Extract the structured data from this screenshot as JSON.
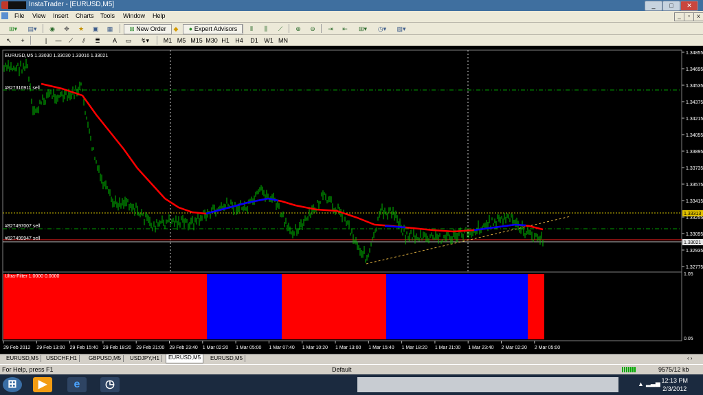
{
  "window": {
    "title": "InstaTrader - [EURUSD,M5]",
    "controls": [
      "_",
      "□",
      "✕"
    ],
    "mdi_controls": [
      "_",
      "▫",
      "x"
    ]
  },
  "menu": [
    "File",
    "View",
    "Insert",
    "Charts",
    "Tools",
    "Window",
    "Help"
  ],
  "toolbar1": {
    "new_order": "New Order",
    "expert_advisors": "Expert Advisors"
  },
  "toolbar2": {
    "text_tool": "A",
    "timeframes": [
      "M1",
      "M5",
      "M15",
      "M30",
      "H1",
      "H4",
      "D1",
      "W1",
      "MN"
    ]
  },
  "chart": {
    "header": "EURUSD,M5  1.33030 1.33030 1.33016 1.33021",
    "orders": [
      "#827316911 sell",
      "#827497007 sell",
      "#827499947 sell"
    ],
    "price_axis": [
      "1.34855",
      "1.34695",
      "1.34535",
      "1.34375",
      "1.34215",
      "1.34055",
      "1.33895",
      "1.33735",
      "1.33575",
      "1.33415",
      "1.33255",
      "1.33095",
      "1.32935",
      "1.32775"
    ],
    "highlight_prices": {
      "bid": "1.33313",
      "current": "1.33021"
    },
    "indicator_label": "Ultra-Filter 1.0000 0.0000",
    "indicator_axis": {
      "top": "1.05",
      "bottom": "0.05"
    },
    "time_axis": [
      "29 Feb 2012",
      "29 Feb 13:00",
      "29 Feb 15:40",
      "29 Feb 18:20",
      "29 Feb 21:00",
      "29 Feb 23:40",
      "1 Mar 02:20",
      "1 Mar 05:00",
      "1 Mar 07:40",
      "1 Mar 10:20",
      "1 Mar 13:00",
      "1 Mar 15:40",
      "1 Mar 18:20",
      "1 Mar 21:00",
      "1 Mar 23:40",
      "2 Mar 02:20",
      "2 Mar 05:00"
    ],
    "colors": {
      "background": "#000000",
      "candles": "#00c000",
      "ma_down": "#ff0000",
      "ma_up": "#0000ff",
      "indicator_red": "#ff0000",
      "indicator_blue": "#0000ff"
    }
  },
  "chart_tabs": [
    "EURUSD,M5",
    "USDCHF,H1",
    "GBPUSD,M5",
    "USDJPY,H1",
    "EURUSD,M5",
    "EURUSD,M5"
  ],
  "active_tab_index": 4,
  "status": {
    "help": "For Help, press F1",
    "profile": "Default",
    "traffic": "9575/12 kb"
  },
  "taskbar": {
    "time": "12:13 PM",
    "date": "2/3/2012"
  }
}
